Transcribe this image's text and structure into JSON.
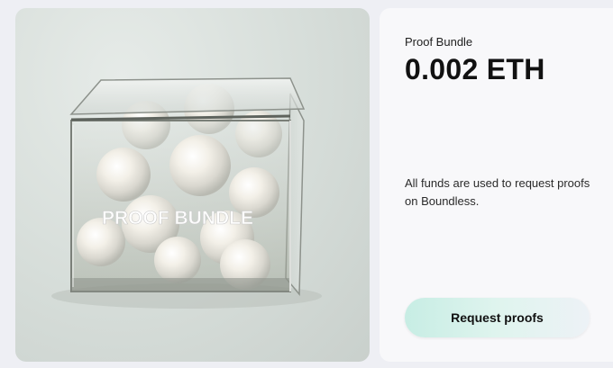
{
  "product": {
    "label": "Proof Bundle",
    "price": "0.002 ETH",
    "description": "All funds are used to request proofs on Boundless.",
    "image_text": "PROOF BUNDLE"
  },
  "actions": {
    "request_label": "Request proofs"
  },
  "colors": {
    "button_gradient_start": "#c7ede4",
    "button_gradient_end": "#edf2f6",
    "card_background": "#f8f8fa"
  }
}
